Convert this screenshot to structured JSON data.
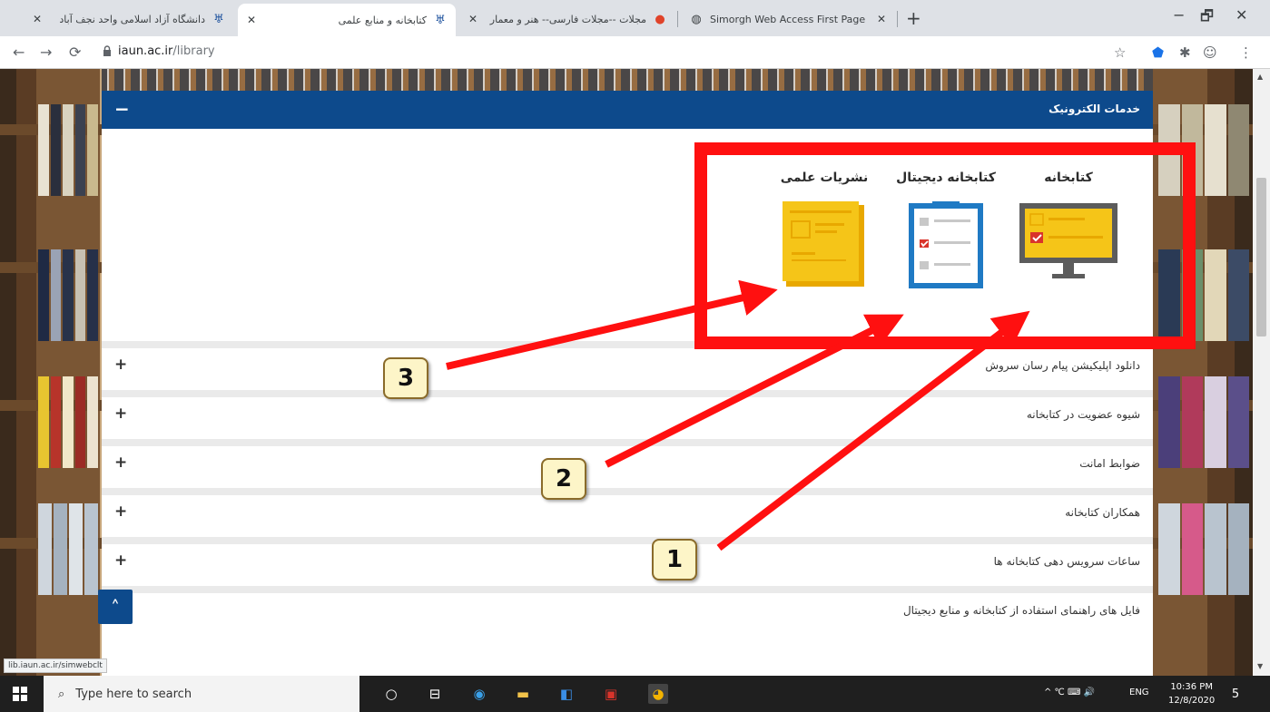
{
  "browser": {
    "tabs": [
      {
        "label": "دانشگاه آزاد اسلامی واحد نجف آباد",
        "active": false
      },
      {
        "label": "کتابخانه و منابع علمی",
        "active": true
      },
      {
        "label": "مجلات --مجلات فارسی-- هنر و معمار",
        "active": false
      },
      {
        "label": "Simorgh Web Access First Page",
        "active": false
      }
    ],
    "new_tab": "+",
    "window_controls": [
      "−",
      "🗗",
      "✕"
    ],
    "url_host": "iaun.ac.ir",
    "url_path": "/library"
  },
  "panel": {
    "title": "خدمات الکترونیک",
    "collapse_symbol": "−",
    "categories": [
      {
        "label": "کتابخانه",
        "icon": "monitor-icon"
      },
      {
        "label": "کتابخانه دیجیتال",
        "icon": "clipboard-icon"
      },
      {
        "label": "نشریات علمی",
        "icon": "journal-icon"
      }
    ],
    "accordion": [
      {
        "label": "دانلود اپلیکیشن پیام رسان سروش",
        "toggle": "+"
      },
      {
        "label": "شیوه عضویت در کتابخانه",
        "toggle": "+"
      },
      {
        "label": "ضوابط امانت",
        "toggle": "+"
      },
      {
        "label": "همکاران کتابخانه",
        "toggle": "+"
      },
      {
        "label": "ساعات سرویس دهی کتابخانه ها",
        "toggle": "+"
      },
      {
        "label": "فایل های راهنمای استفاده از کتابخانه و منابع دیجیتال",
        "toggle": ""
      }
    ],
    "scroll_top_symbol": "˄"
  },
  "annotations": {
    "callouts": [
      "1",
      "2",
      "3"
    ],
    "color": "#ff1010"
  },
  "status_link": "lib.iaun.ac.ir/simwebclt",
  "taskbar": {
    "search_placeholder": "Type here to search",
    "tray_lang": "ENG",
    "tray_misc": "^ ℃ ⌨ 🔊",
    "time": "10:36 PM",
    "date": "12/8/2020",
    "notification_count": "5"
  }
}
